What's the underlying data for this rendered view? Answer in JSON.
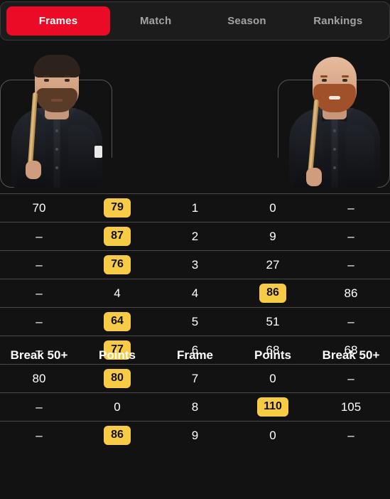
{
  "tabs": [
    {
      "label": "Frames",
      "active": true
    },
    {
      "label": "Match",
      "active": false
    },
    {
      "label": "Season",
      "active": false
    },
    {
      "label": "Rankings",
      "active": false
    }
  ],
  "players": {
    "left": {
      "photo_alt": "player-photo-left"
    },
    "right": {
      "photo_alt": "player-photo-right"
    }
  },
  "table": {
    "headers": [
      "Break 50+",
      "Points",
      "Frame",
      "Points",
      "Break 50+"
    ],
    "rows": [
      {
        "break_left": "70",
        "points_left": "79",
        "points_left_badge": true,
        "frame": "1",
        "points_right": "0",
        "points_right_badge": false,
        "break_right": "–"
      },
      {
        "break_left": "–",
        "points_left": "87",
        "points_left_badge": true,
        "frame": "2",
        "points_right": "9",
        "points_right_badge": false,
        "break_right": "–"
      },
      {
        "break_left": "–",
        "points_left": "76",
        "points_left_badge": true,
        "frame": "3",
        "points_right": "27",
        "points_right_badge": false,
        "break_right": "–"
      },
      {
        "break_left": "–",
        "points_left": "4",
        "points_left_badge": false,
        "frame": "4",
        "points_right": "86",
        "points_right_badge": true,
        "break_right": "86"
      },
      {
        "break_left": "–",
        "points_left": "64",
        "points_left_badge": true,
        "frame": "5",
        "points_right": "51",
        "points_right_badge": false,
        "break_right": "–"
      },
      {
        "break_left": "–",
        "points_left": "77",
        "points_left_badge": true,
        "frame": "6",
        "points_right": "68",
        "points_right_badge": false,
        "break_right": "68"
      },
      {
        "break_left": "80",
        "points_left": "80",
        "points_left_badge": true,
        "frame": "7",
        "points_right": "0",
        "points_right_badge": false,
        "break_right": "–"
      },
      {
        "break_left": "–",
        "points_left": "0",
        "points_left_badge": false,
        "frame": "8",
        "points_right": "110",
        "points_right_badge": true,
        "break_right": "105"
      },
      {
        "break_left": "–",
        "points_left": "86",
        "points_left_badge": true,
        "frame": "9",
        "points_right": "0",
        "points_right_badge": false,
        "break_right": "–"
      }
    ]
  },
  "colors": {
    "background": "#121212",
    "tab_active": "#ec0b26",
    "tab_inactive_text": "#a3a3a3",
    "badge": "#f8cb46",
    "divider": "#4a4a4a"
  }
}
